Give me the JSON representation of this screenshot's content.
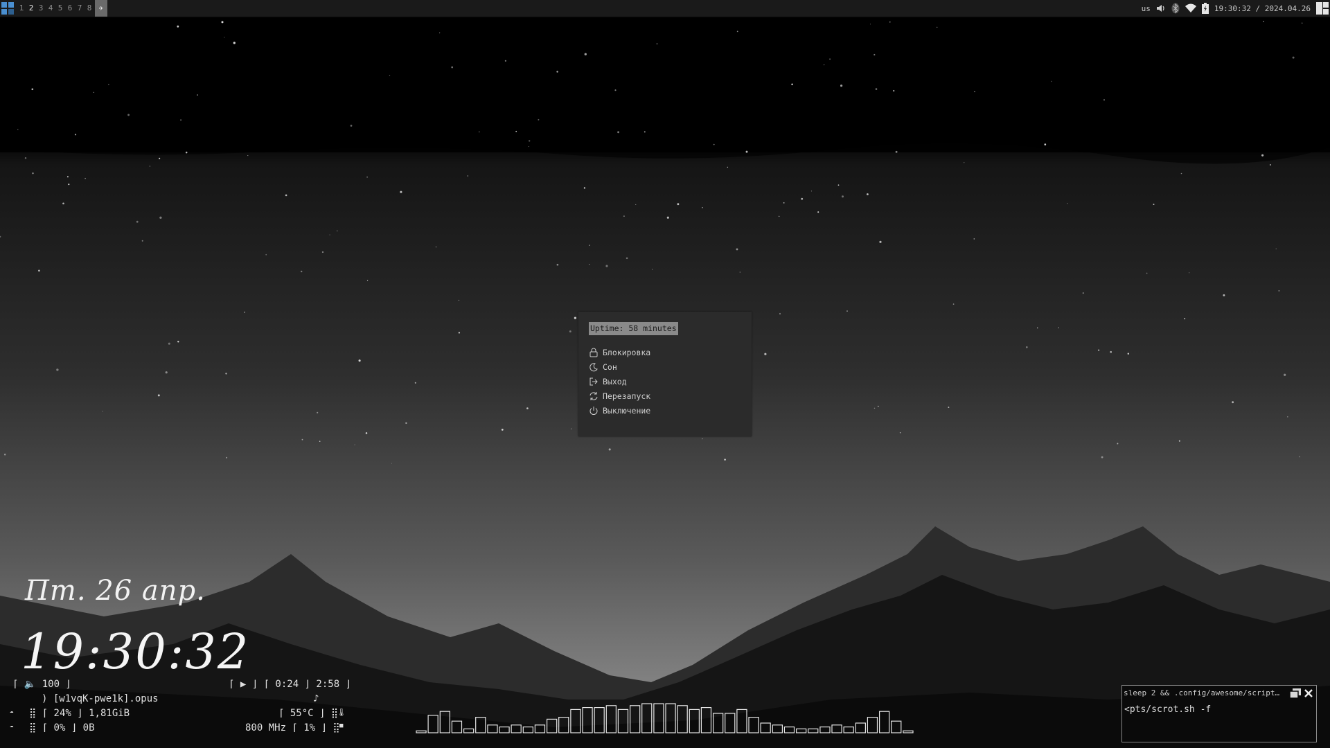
{
  "topbar": {
    "tags": [
      "1",
      "2",
      "3",
      "4",
      "5",
      "6",
      "7",
      "8"
    ],
    "active_tag": "2",
    "layout_glyph": "✈",
    "keyboard_layout": "us",
    "clock": "19:30:32 / 2024.04.26",
    "icons": [
      "launcher-icon",
      "volume-icon",
      "bluetooth-icon",
      "wifi-icon",
      "battery-icon",
      "layout-icon"
    ]
  },
  "session_menu": {
    "uptime": "Uptime: 58 minutes",
    "items": [
      {
        "label": "Блокировка",
        "icon": "lock-icon"
      },
      {
        "label": "Сон",
        "icon": "moon-icon"
      },
      {
        "label": "Выход",
        "icon": "logout-icon"
      },
      {
        "label": "Перезапуск",
        "icon": "restart-icon"
      },
      {
        "label": "Выключение",
        "icon": "power-icon"
      }
    ]
  },
  "datetime": {
    "date": "Пт. 26 апр.",
    "time": "19:30:32"
  },
  "widgets": {
    "volume": "⌈ 🔈 100 ⌋",
    "track": ") [w1vqK-pwe1k].opus",
    "player": "⌈ ▶ ⌋ ⌈ 0:24 ⌋ 2:58 ⌋",
    "note": "♪",
    "memory": "⣿ ⌈ 24% ⌋ 1,81GiB",
    "swap": "⣿ ⌈ 0% ⌋ 0B",
    "temp": "⌈ 55°C ⌋ ⣿",
    "cpu": "800 MHz ⌈ 1% ⌋ ⣿",
    "mem_icon": "☁",
    "swap_icon": "☁",
    "temp_icon": "🌡",
    "cpu_icon": "■"
  },
  "visualizer": {
    "levels": [
      0.05,
      0.45,
      0.55,
      0.3,
      0.1,
      0.4,
      0.2,
      0.15,
      0.2,
      0.15,
      0.2,
      0.35,
      0.4,
      0.6,
      0.65,
      0.65,
      0.7,
      0.6,
      0.7,
      0.75,
      0.75,
      0.75,
      0.7,
      0.6,
      0.65,
      0.5,
      0.5,
      0.6,
      0.4,
      0.25,
      0.2,
      0.15,
      0.1,
      0.1,
      0.15,
      0.2,
      0.15,
      0.25,
      0.4,
      0.55,
      0.3,
      0.05
    ]
  },
  "terminal": {
    "title": "sleep 2 && .config/awesome/scripts/scr…",
    "line": "<pts/scrot.sh -f"
  },
  "colors": {
    "bar_bg": "#1a1a1a",
    "menu_bg": "#2b2b2b",
    "uptime_bg": "#8a8a8a"
  }
}
